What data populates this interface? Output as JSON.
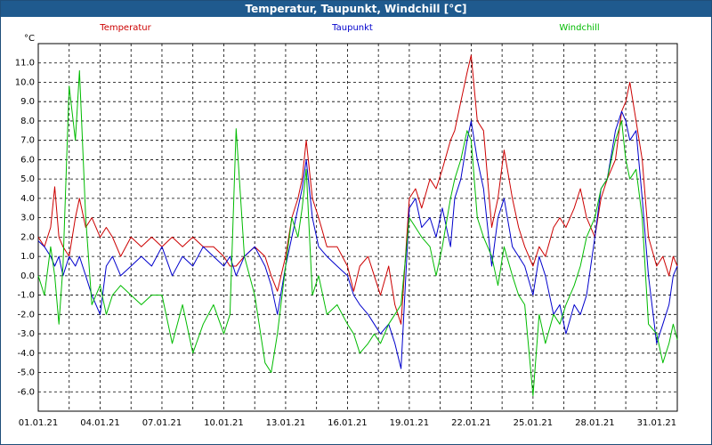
{
  "window": {
    "title": "Temperatur, Taupunkt, Windchill [°C]"
  },
  "chart_data": {
    "type": "line",
    "title": "Temperatur, Taupunkt, Windchill [°C]",
    "ylabel": "°C",
    "xlabel": "",
    "ylim": [
      -7,
      12
    ],
    "xlim": [
      0,
      31
    ],
    "grid": true,
    "legend_position": "top",
    "y_ticks": [
      "11.0",
      "10.0",
      "9.0",
      "8.0",
      "7.0",
      "6.0",
      "5.0",
      "4.0",
      "3.0",
      "2.0",
      "1.0",
      "0.0",
      "-1.0",
      "-2.0",
      "-3.0",
      "-4.0",
      "-5.0",
      "-6.0"
    ],
    "x_ticks": [
      {
        "x": 0,
        "label": "01.01.21"
      },
      {
        "x": 3,
        "label": "04.01.21"
      },
      {
        "x": 6,
        "label": "07.01.21"
      },
      {
        "x": 9,
        "label": "10.01.21"
      },
      {
        "x": 12,
        "label": "13.01.21"
      },
      {
        "x": 15,
        "label": "16.01.21"
      },
      {
        "x": 18,
        "label": "19.01.21"
      },
      {
        "x": 21,
        "label": "22.01.21"
      },
      {
        "x": 24,
        "label": "25.01.21"
      },
      {
        "x": 27,
        "label": "28.01.21"
      },
      {
        "x": 30,
        "label": "31.01.21"
      }
    ],
    "series": [
      {
        "name": "Temperatur",
        "color": "#cc0000",
        "x": [
          0,
          0.3,
          0.6,
          0.8,
          1.0,
          1.2,
          1.5,
          1.8,
          2.0,
          2.3,
          2.6,
          3.0,
          3.3,
          3.6,
          4.0,
          4.5,
          5.0,
          5.5,
          6.0,
          6.5,
          7.0,
          7.5,
          8.0,
          8.5,
          9.0,
          9.3,
          9.6,
          10.0,
          10.5,
          11.0,
          11.3,
          11.6,
          12.0,
          12.3,
          12.6,
          12.8,
          13.0,
          13.3,
          13.6,
          14.0,
          14.5,
          15.0,
          15.3,
          15.6,
          16.0,
          16.3,
          16.6,
          17.0,
          17.3,
          17.6,
          18.0,
          18.3,
          18.6,
          19.0,
          19.3,
          19.6,
          20.0,
          20.2,
          20.5,
          20.8,
          21.0,
          21.3,
          21.6,
          22.0,
          22.3,
          22.6,
          23.0,
          23.3,
          23.6,
          24.0,
          24.3,
          24.6,
          25.0,
          25.3,
          25.6,
          26.0,
          26.3,
          26.6,
          27.0,
          27.3,
          27.6,
          28.0,
          28.3,
          28.5,
          28.7,
          29.0,
          29.3,
          29.6,
          30.0,
          30.3,
          30.6,
          30.8,
          31.0
        ],
        "values": [
          2.0,
          1.5,
          2.5,
          4.6,
          2.0,
          1.5,
          1.0,
          3.0,
          4.0,
          2.5,
          3.0,
          2.0,
          2.5,
          2.0,
          1.0,
          2.0,
          1.5,
          2.0,
          1.5,
          2.0,
          1.5,
          2.0,
          1.5,
          1.5,
          1.0,
          0.5,
          0.5,
          1.0,
          1.5,
          1.0,
          0.0,
          -0.8,
          1.0,
          3.0,
          4.0,
          5.0,
          7.0,
          4.0,
          3.0,
          1.5,
          1.5,
          0.5,
          -0.8,
          0.5,
          1.0,
          0.0,
          -1.0,
          0.5,
          -1.5,
          -2.5,
          4.0,
          4.5,
          3.5,
          5.0,
          4.5,
          5.5,
          7.0,
          7.5,
          9.0,
          10.5,
          11.4,
          8.0,
          7.5,
          2.5,
          4.0,
          6.5,
          4.0,
          2.5,
          1.5,
          0.5,
          1.5,
          1.0,
          2.5,
          3.0,
          2.5,
          3.5,
          4.5,
          3.0,
          2.0,
          4.0,
          5.0,
          6.0,
          8.5,
          9.0,
          10.0,
          8.0,
          6.0,
          2.0,
          0.5,
          1.0,
          0.0,
          1.0,
          0.5
        ]
      },
      {
        "name": "Taupunkt",
        "color": "#0000cc",
        "x": [
          0,
          0.3,
          0.6,
          0.8,
          1.0,
          1.2,
          1.5,
          1.8,
          2.0,
          2.3,
          2.6,
          3.0,
          3.3,
          3.6,
          4.0,
          4.5,
          5.0,
          5.5,
          6.0,
          6.5,
          7.0,
          7.5,
          8.0,
          8.5,
          9.0,
          9.3,
          9.6,
          10.0,
          10.5,
          11.0,
          11.3,
          11.6,
          12.0,
          12.3,
          12.6,
          12.8,
          13.0,
          13.3,
          13.6,
          14.0,
          14.5,
          15.0,
          15.3,
          15.6,
          16.0,
          16.3,
          16.6,
          17.0,
          17.3,
          17.6,
          18.0,
          18.3,
          18.6,
          19.0,
          19.3,
          19.6,
          20.0,
          20.2,
          20.5,
          20.8,
          21.0,
          21.3,
          21.6,
          22.0,
          22.3,
          22.6,
          23.0,
          23.3,
          23.6,
          24.0,
          24.3,
          24.6,
          25.0,
          25.3,
          25.6,
          26.0,
          26.3,
          26.6,
          27.0,
          27.3,
          27.6,
          28.0,
          28.3,
          28.5,
          28.7,
          29.0,
          29.3,
          29.6,
          30.0,
          30.3,
          30.6,
          30.8,
          31.0
        ],
        "values": [
          1.8,
          1.5,
          1.0,
          0.5,
          1.0,
          0.0,
          1.0,
          0.5,
          1.0,
          0.0,
          -1.0,
          -2.0,
          0.5,
          1.0,
          0.0,
          0.5,
          1.0,
          0.5,
          1.5,
          0.0,
          1.0,
          0.5,
          1.5,
          1.0,
          0.5,
          1.0,
          0.0,
          1.0,
          1.5,
          0.5,
          -0.5,
          -2.0,
          0.5,
          2.0,
          3.5,
          4.5,
          6.0,
          3.0,
          1.5,
          1.0,
          0.5,
          0.0,
          -1.0,
          -1.5,
          -2.0,
          -2.5,
          -3.0,
          -2.5,
          -3.5,
          -4.8,
          3.5,
          4.0,
          2.5,
          3.0,
          2.0,
          3.5,
          1.5,
          4.0,
          5.0,
          7.0,
          8.0,
          6.0,
          4.5,
          0.5,
          3.0,
          4.0,
          1.5,
          1.0,
          0.5,
          -1.0,
          1.0,
          0.0,
          -2.0,
          -1.5,
          -3.0,
          -1.5,
          -2.0,
          -1.0,
          2.0,
          4.5,
          5.0,
          7.5,
          8.5,
          8.0,
          7.0,
          7.5,
          4.0,
          0.0,
          -3.5,
          -2.5,
          -1.5,
          0.0,
          0.5
        ]
      },
      {
        "name": "Windchill",
        "color": "#00bb00",
        "x": [
          0,
          0.3,
          0.6,
          0.8,
          1.0,
          1.2,
          1.5,
          1.8,
          2.0,
          2.3,
          2.6,
          3.0,
          3.3,
          3.6,
          4.0,
          4.5,
          5.0,
          5.5,
          6.0,
          6.5,
          7.0,
          7.5,
          8.0,
          8.5,
          9.0,
          9.3,
          9.6,
          10.0,
          10.5,
          11.0,
          11.3,
          11.6,
          12.0,
          12.3,
          12.6,
          12.8,
          13.0,
          13.3,
          13.6,
          14.0,
          14.5,
          15.0,
          15.3,
          15.6,
          16.0,
          16.3,
          16.6,
          17.0,
          17.3,
          17.6,
          18.0,
          18.3,
          18.6,
          19.0,
          19.3,
          19.6,
          20.0,
          20.2,
          20.5,
          20.8,
          21.0,
          21.3,
          21.6,
          22.0,
          22.3,
          22.6,
          23.0,
          23.3,
          23.6,
          24.0,
          24.3,
          24.6,
          25.0,
          25.3,
          25.6,
          26.0,
          26.3,
          26.6,
          27.0,
          27.3,
          27.6,
          28.0,
          28.3,
          28.5,
          28.7,
          29.0,
          29.3,
          29.6,
          30.0,
          30.3,
          30.6,
          30.8,
          31.0
        ],
        "values": [
          0.0,
          -1.0,
          1.5,
          0.0,
          -2.5,
          0.5,
          9.8,
          7.0,
          10.6,
          3.0,
          -1.5,
          -0.5,
          -2.0,
          -1.0,
          -0.5,
          -1.0,
          -1.5,
          -1.0,
          -1.0,
          -3.5,
          -1.5,
          -4.0,
          -2.5,
          -1.5,
          -3.0,
          -2.0,
          7.6,
          1.0,
          -1.0,
          -4.5,
          -5.0,
          -3.0,
          0.5,
          3.0,
          2.0,
          3.5,
          5.5,
          -1.0,
          0.0,
          -2.0,
          -1.5,
          -2.5,
          -3.0,
          -4.0,
          -3.5,
          -3.0,
          -3.5,
          -2.5,
          -2.0,
          -1.5,
          3.0,
          2.5,
          2.0,
          1.5,
          0.0,
          1.5,
          4.0,
          5.0,
          6.0,
          7.5,
          7.0,
          3.0,
          2.0,
          1.0,
          -0.5,
          1.5,
          0.0,
          -1.0,
          -1.5,
          -6.2,
          -2.0,
          -3.5,
          -2.0,
          -2.5,
          -1.5,
          -0.5,
          0.5,
          2.0,
          3.0,
          4.5,
          5.0,
          7.0,
          8.0,
          6.0,
          5.0,
          5.5,
          3.0,
          -2.5,
          -3.0,
          -4.5,
          -3.5,
          -2.5,
          -3.3
        ]
      }
    ]
  }
}
